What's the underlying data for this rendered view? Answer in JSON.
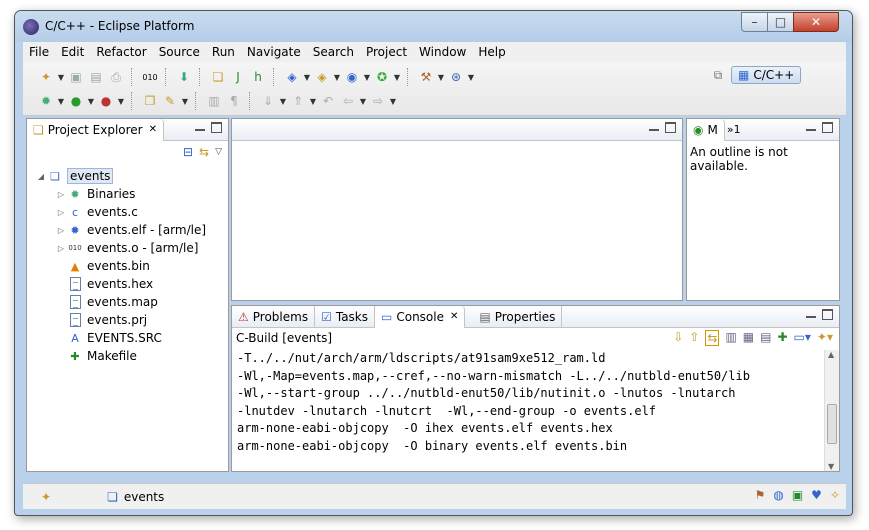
{
  "window": {
    "title": "C/C++ - Eclipse Platform",
    "min_glyph": "–",
    "max_glyph": "□",
    "close_glyph": "✕"
  },
  "menu": [
    "File",
    "Edit",
    "Refactor",
    "Source",
    "Run",
    "Navigate",
    "Search",
    "Project",
    "Window",
    "Help"
  ],
  "perspective": {
    "label": "C/C++"
  },
  "project_explorer": {
    "title": "Project Explorer",
    "items": [
      {
        "label": "events",
        "level": 0,
        "expanded": true,
        "icon": "project-folder-icon"
      },
      {
        "label": "Binaries",
        "level": 1,
        "expanded": false,
        "icon": "binaries-icon"
      },
      {
        "label": "events.c",
        "level": 1,
        "expanded": false,
        "icon": "c-file-icon"
      },
      {
        "label": "events.elf - [arm/le]",
        "level": 1,
        "expanded": false,
        "icon": "elf-binary-icon"
      },
      {
        "label": "events.o - [arm/le]",
        "level": 1,
        "expanded": false,
        "icon": "object-file-icon"
      },
      {
        "label": "events.bin",
        "level": 1,
        "icon": "bin-file-icon"
      },
      {
        "label": "events.hex",
        "level": 1,
        "icon": "text-file-icon"
      },
      {
        "label": "events.map",
        "level": 1,
        "icon": "text-file-icon"
      },
      {
        "label": "events.prj",
        "level": 1,
        "icon": "text-file-icon"
      },
      {
        "label": "EVENTS.SRC",
        "level": 1,
        "icon": "src-file-icon"
      },
      {
        "label": "Makefile",
        "level": 1,
        "icon": "makefile-icon"
      }
    ]
  },
  "outline": {
    "tab_label": "M",
    "overflow_label": "»1",
    "message": "An outline is not available."
  },
  "bottom_tabs": [
    {
      "label": "Problems",
      "active": false
    },
    {
      "label": "Tasks",
      "active": false
    },
    {
      "label": "Console",
      "active": true
    },
    {
      "label": "Properties",
      "active": false
    }
  ],
  "console": {
    "header": "C-Build [events]",
    "lines": [
      "-T../../nut/arch/arm/ldscripts/at91sam9xe512_ram.ld",
      "-Wl,-Map=events.map,--cref,--no-warn-mismatch -L../../nutbld-enut50/lib",
      "-Wl,--start-group ../../nutbld-enut50/lib/nutinit.o -lnutos -lnutarch",
      "-lnutdev -lnutarch -lnutcrt  -Wl,--end-group -o events.elf",
      "arm-none-eabi-objcopy  -O ihex events.elf events.hex",
      "arm-none-eabi-objcopy  -O binary events.elf events.bin"
    ]
  },
  "status": {
    "selected": "events"
  }
}
